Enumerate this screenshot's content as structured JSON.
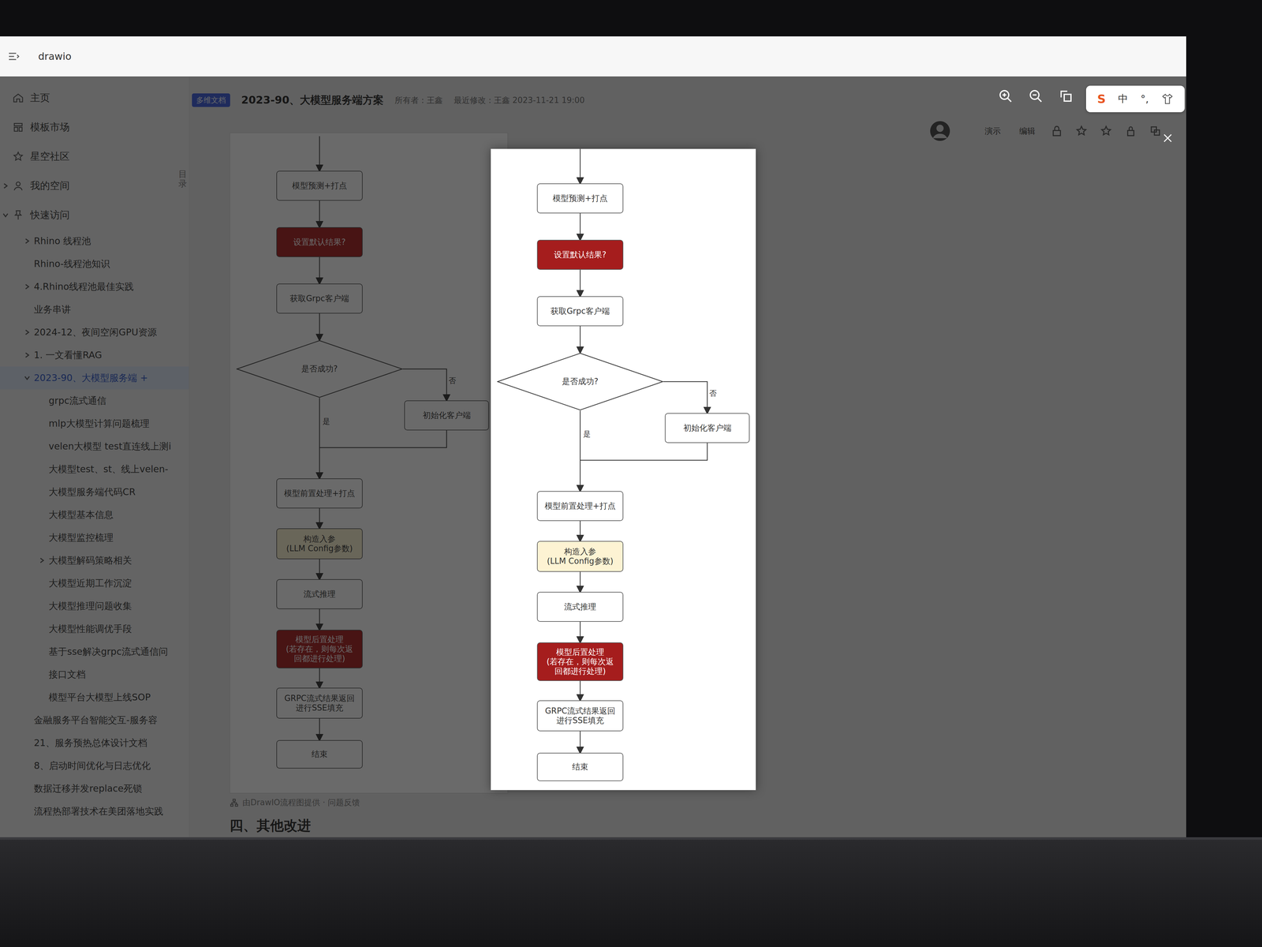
{
  "app": {
    "title": "drawio"
  },
  "sidebar": {
    "toc_label": "目录",
    "nav": [
      {
        "label": "主页",
        "selected": false
      },
      {
        "label": "模板市场",
        "selected": false
      },
      {
        "label": "星空社区",
        "selected": false
      },
      {
        "label": "我的空间",
        "selected": false,
        "expanded": false
      },
      {
        "label": "快速访问",
        "selected": false,
        "expanded": true
      }
    ],
    "quick_access": [
      {
        "label": "Rhino 线程池",
        "selected": false,
        "expanded": false
      },
      {
        "label": "Rhino-线程池知识",
        "selected": false
      },
      {
        "label": "4.Rhino线程池最佳实践",
        "selected": false,
        "expanded": false
      },
      {
        "label": "业务串讲",
        "selected": false
      },
      {
        "label": "2024-12、夜间空闲GPU资源",
        "selected": false,
        "expanded": false
      },
      {
        "label": "1. 一文看懂RAG",
        "selected": false,
        "expanded": false
      },
      {
        "label": "2023-90、大模型服务端 +",
        "selected": true,
        "expanded": true,
        "children": [
          {
            "label": "grpc流式通信",
            "selected": false
          },
          {
            "label": "mlp大模型计算问题梳理",
            "selected": false
          },
          {
            "label": "velen大模型 test直连线上测i",
            "selected": false
          },
          {
            "label": "大模型test、st、线上velen-",
            "selected": false
          },
          {
            "label": "大模型服务端代码CR",
            "selected": false
          },
          {
            "label": "大模型基本信息",
            "selected": false
          },
          {
            "label": "大模型监控梳理",
            "selected": false
          },
          {
            "label": "大模型解码策略相关",
            "selected": false,
            "expanded": false
          },
          {
            "label": "大模型近期工作沉淀",
            "selected": false
          },
          {
            "label": "大模型推理问题收集",
            "selected": false
          },
          {
            "label": "大模型性能调优手段",
            "selected": false
          },
          {
            "label": "基于sse解决grpc流式通信问",
            "selected": false
          },
          {
            "label": "接口文档",
            "selected": false
          },
          {
            "label": "模型平台大模型上线SOP",
            "selected": false
          }
        ]
      },
      {
        "label": "金融服务平台智能交互-服务容",
        "selected": false
      },
      {
        "label": "21、服务预热总体设计文档",
        "selected": false
      },
      {
        "label": "8、启动时间优化与日志优化",
        "selected": false
      },
      {
        "label": "数据迁移并发replace死锁",
        "selected": false
      },
      {
        "label": "流程热部署技术在美团落地实践",
        "selected": false
      }
    ]
  },
  "document": {
    "badge": "多维文档",
    "title": "2023-90、大模型服务端方案",
    "owner": "所有者：王鑫",
    "modified": "最近修改：王鑫 2023-11-21 19:00",
    "actions": [
      "演示",
      "编辑"
    ],
    "footer": "由DrawIO流程图提供 · 问题反馈",
    "next_heading": "四、其他改进"
  },
  "ime": {
    "logo": "S",
    "mode": "中",
    "punct": "°,"
  },
  "diagram": {
    "nodes": [
      {
        "text": "模型预测+打点",
        "kind": "process",
        "color": "#ffffff"
      },
      {
        "text": "设置默认结果?",
        "kind": "process",
        "color": "#a51d1d"
      },
      {
        "text": "获取Grpc客户端",
        "kind": "process",
        "color": "#ffffff"
      },
      {
        "text": "是否成功?",
        "kind": "decision",
        "color": "#ffffff"
      },
      {
        "text": "初始化客户端",
        "kind": "process",
        "color": "#ffffff"
      },
      {
        "text": "模型前置处理+打点",
        "kind": "process",
        "color": "#ffffff"
      },
      {
        "text": "构造入参\n(LLM Config参数)",
        "kind": "process",
        "color": "#fdf3d3"
      },
      {
        "text": "流式推理",
        "kind": "process",
        "color": "#ffffff"
      },
      {
        "text": "模型后置处理\n(若存在，则每次返\n回都进行处理)",
        "kind": "process",
        "color": "#a51d1d"
      },
      {
        "text": "GRPC流式结果返回\n进行SSE填充",
        "kind": "process",
        "color": "#ffffff"
      },
      {
        "text": "结束",
        "kind": "process",
        "color": "#ffffff"
      }
    ],
    "edge_labels": {
      "yes": "是",
      "no": "否"
    }
  }
}
